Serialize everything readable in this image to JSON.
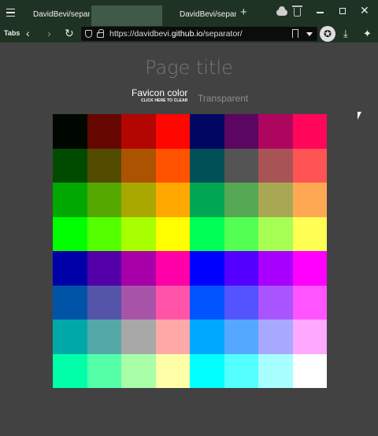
{
  "browser": {
    "tabs": [
      {
        "label": "DavidBevi/separ"
      },
      {
        "label": ""
      },
      {
        "label": "DavidBevi/separ"
      }
    ],
    "tabs_button_label": "Tabs",
    "icons": {
      "menu": "hamburger-icon",
      "new_tab": "+",
      "close": "✕",
      "back": "‹",
      "forward": "›",
      "reload": "↻",
      "download": "⤓",
      "puzzle": "✦",
      "extension": "✪"
    },
    "url": {
      "prefix": "https://davidbevi.",
      "host_bold": "github.io",
      "suffix": "/separator/"
    }
  },
  "page": {
    "title": "Page title",
    "favicon_button": {
      "label": "Favicon color",
      "sublabel": "CLICK HERE TO CLEAR"
    },
    "transparent_label": "Transparent",
    "swatches": [
      [
        "#000600",
        "#660600",
        "#b30600",
        "#ff0600",
        "#000661",
        "#5b0660",
        "#ad065f",
        "#ff065a"
      ],
      [
        "#004b00",
        "#534b00",
        "#ab5300",
        "#ff5300",
        "#005057",
        "#545454",
        "#a85454",
        "#ff5454"
      ],
      [
        "#00a800",
        "#54a800",
        "#a8a800",
        "#ffa800",
        "#00a854",
        "#54a854",
        "#a8a854",
        "#ffa854"
      ],
      [
        "#00ff00",
        "#54ff00",
        "#a8ff00",
        "#ffff00",
        "#00ff54",
        "#54ff54",
        "#a8ff54",
        "#ffff54"
      ],
      [
        "#0000a8",
        "#5400a8",
        "#a800a8",
        "#ff00a8",
        "#0000ff",
        "#5400ff",
        "#a800ff",
        "#ff00ff"
      ],
      [
        "#0054a8",
        "#5454a8",
        "#a854a8",
        "#ff54a8",
        "#0054ff",
        "#5454ff",
        "#a854ff",
        "#ff54ff"
      ],
      [
        "#00a8a8",
        "#54a8a8",
        "#a8a8a8",
        "#ffa8a8",
        "#00a8ff",
        "#54a8ff",
        "#a8a8ff",
        "#ffa8ff"
      ],
      [
        "#00ffa8",
        "#54ffa8",
        "#a8ffa8",
        "#ffffa8",
        "#00ffff",
        "#54ffff",
        "#a8ffff",
        "#ffffff"
      ]
    ]
  }
}
